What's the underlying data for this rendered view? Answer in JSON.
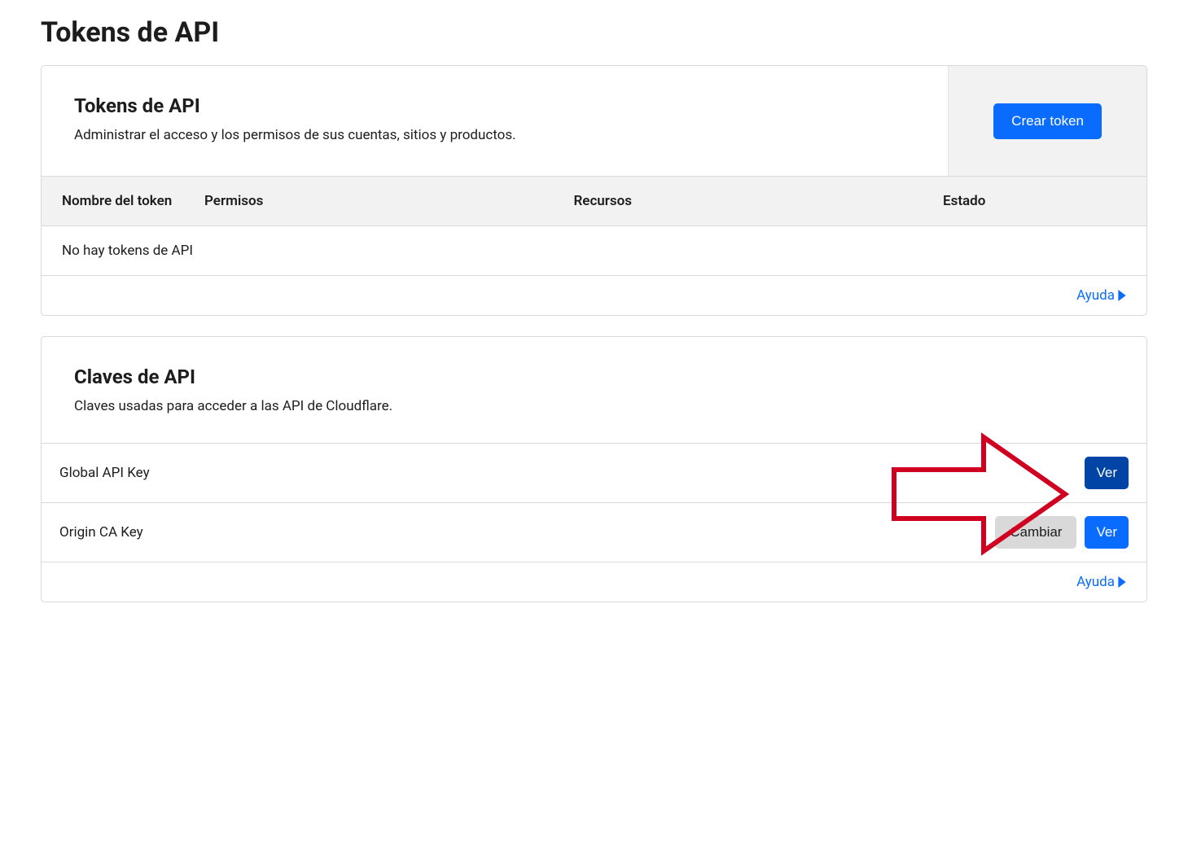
{
  "page": {
    "title": "Tokens de API"
  },
  "tokensCard": {
    "title": "Tokens de API",
    "subtitle": "Administrar el acceso y los permisos de sus cuentas, sitios y productos.",
    "createButton": "Crear token",
    "columns": {
      "tokenName": "Nombre del token",
      "permisos": "Permisos",
      "recursos": "Recursos",
      "estado": "Estado"
    },
    "emptyMessage": "No hay tokens de API",
    "helpLink": "Ayuda"
  },
  "keysCard": {
    "title": "Claves de API",
    "subtitle": "Claves usadas para acceder a las API de Cloudflare.",
    "rows": [
      {
        "name": "Global API Key",
        "changeLabel": null,
        "viewLabel": "Ver",
        "viewDark": true
      },
      {
        "name": "Origin CA Key",
        "changeLabel": "Cambiar",
        "viewLabel": "Ver",
        "viewDark": false
      }
    ],
    "helpLink": "Ayuda"
  }
}
